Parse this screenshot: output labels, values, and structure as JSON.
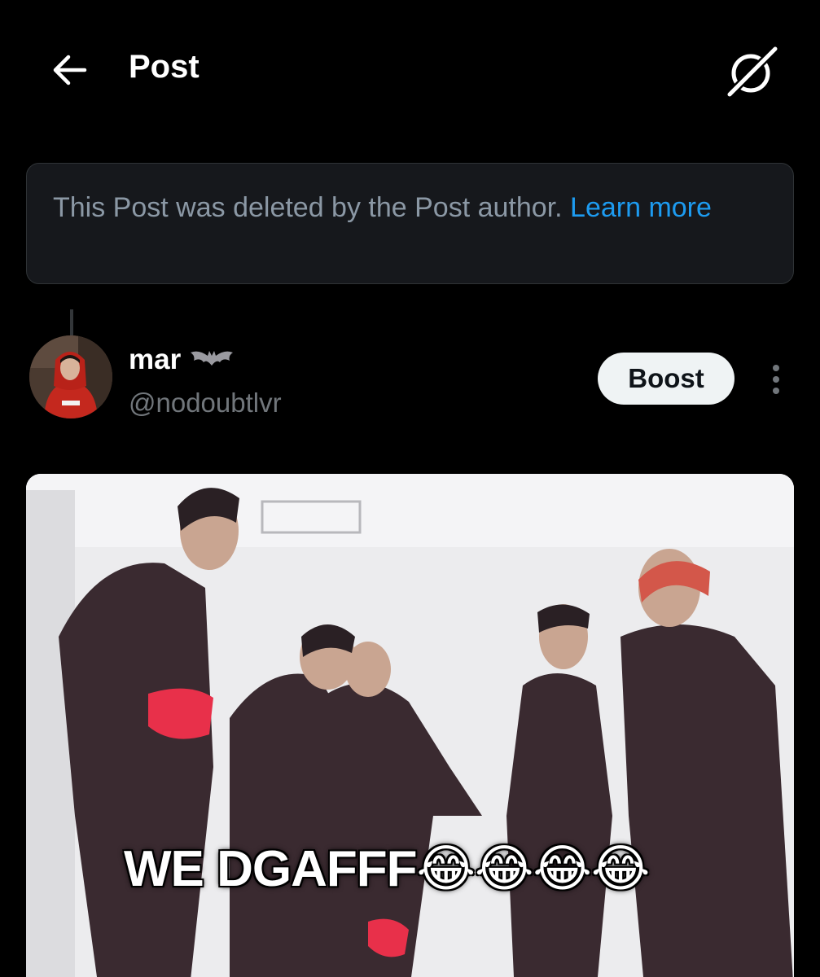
{
  "header": {
    "title": "Post",
    "back_icon": "arrow-left-icon",
    "grok_icon": "grok-icon"
  },
  "notice": {
    "text": "This Post was deleted by the Post author.",
    "link": "Learn more"
  },
  "post": {
    "display_name": "mar",
    "name_emoji": "bat-emoji-icon",
    "handle": "@nodoubtlvr",
    "boost_label": "Boost",
    "more_icon": "more-vertical-icon",
    "media": {
      "caption_text": "WE DGAFFF",
      "caption_emojis": [
        "😂",
        "😂",
        "😂",
        "😂"
      ]
    }
  },
  "colors": {
    "background": "#000000",
    "link": "#1d9bf0",
    "notice_bg": "#16181c",
    "muted": "#71767b"
  }
}
